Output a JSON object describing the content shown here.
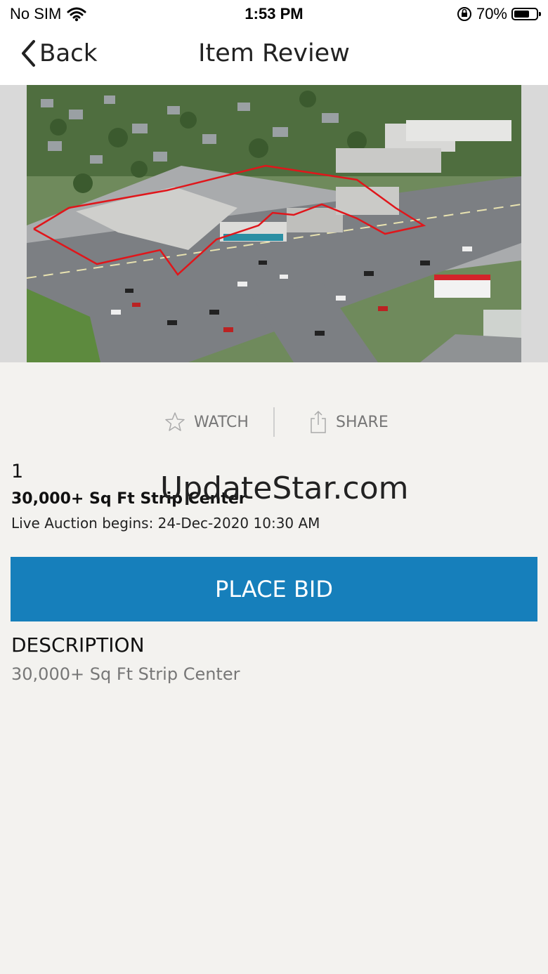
{
  "status_bar": {
    "carrier": "No SIM",
    "time": "1:53 PM",
    "battery_percent": "70%",
    "battery_level": 0.7,
    "icons": [
      "wifi-icon",
      "orientation-lock-icon",
      "battery-icon"
    ]
  },
  "nav": {
    "back_label": "Back",
    "title": "Item Review",
    "icon": "chevron-left-icon"
  },
  "item": {
    "photo_description_icon": "aerial-photo",
    "actions": {
      "watch_label": "WATCH",
      "watch_icon": "star-icon",
      "share_label": "SHARE",
      "share_icon": "share-icon"
    },
    "lot_number": "1",
    "title": "30,000+ Sq Ft Strip Center",
    "auction_date": "Live Auction begins: 24-Dec-2020 10:30 AM",
    "place_bid_label": "PLACE BID",
    "description_heading": "DESCRIPTION",
    "description_body": "30,000+ Sq Ft Strip Center"
  },
  "watermark": "UpdateStar.com",
  "colors": {
    "accent": "#167fbb",
    "background": "#f3f2ef",
    "muted_text": "#777777",
    "outline_red": "#e0161b"
  }
}
